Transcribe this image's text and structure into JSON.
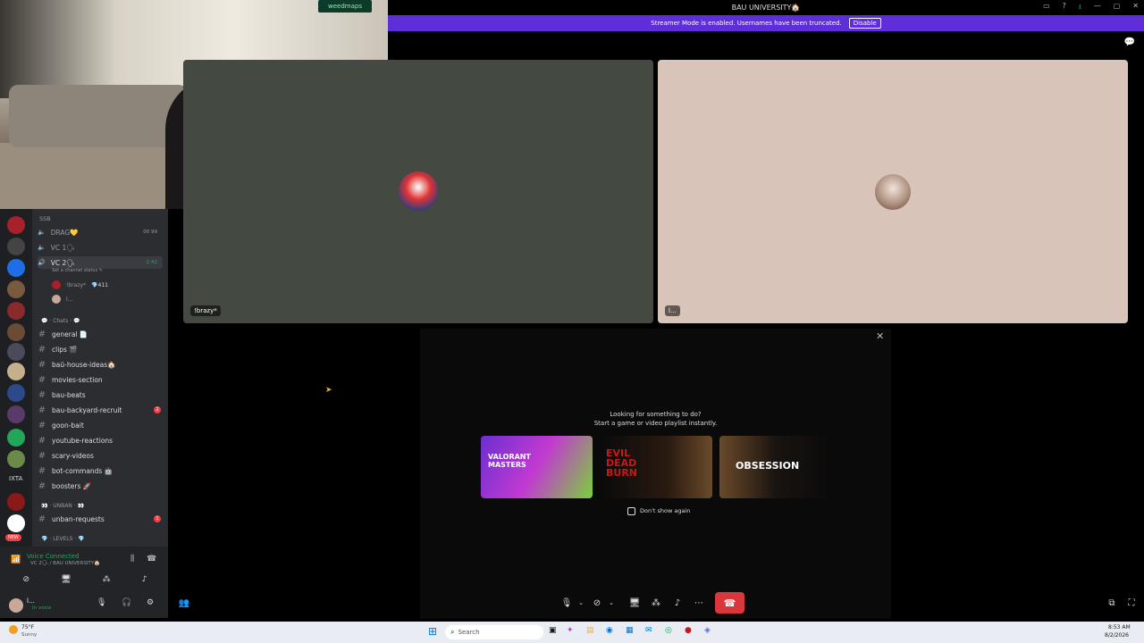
{
  "titlebar": {
    "title": "BAU UNIVERSITY🏠"
  },
  "streamer": {
    "message": "Streamer Mode is enabled. Usernames have been truncated.",
    "disable_label": "Disable",
    "close": "✕"
  },
  "webcam": {
    "logo": "weedmaps"
  },
  "channels": {
    "section_ssb": "SSB",
    "voice": [
      {
        "name": "DRAG💛",
        "meta": "00 99"
      },
      {
        "name": "VC 1🗣"
      },
      {
        "name": "VC 2🗣",
        "meta": "1:42",
        "status": "Set a channel status ✎"
      }
    ],
    "vc_users": [
      {
        "name": "!brazy*",
        "tag": "💎411"
      },
      {
        "name": "l..."
      }
    ],
    "section_chats": "💬 · Chats · 💬",
    "text": [
      {
        "name": "general 📄"
      },
      {
        "name": "clips 🎬"
      },
      {
        "name": "baü-house-ideas🏠"
      },
      {
        "name": "movies-section"
      },
      {
        "name": "bau-beats"
      },
      {
        "name": "bau-backyard-recruit",
        "badge": "2"
      },
      {
        "name": "goon-bait"
      },
      {
        "name": "youtube-reactions"
      },
      {
        "name": "scary-videos"
      },
      {
        "name": "bot-commands 🤖"
      },
      {
        "name": "boosters 🚀"
      }
    ],
    "section_unban": "👀 · UNBAN · 👀",
    "unban_requests": {
      "name": "unban-requests",
      "badge": "1"
    },
    "section_levels": "💎 · LEVELS · 💎"
  },
  "voice_panel": {
    "status": "Voice Connected",
    "location": "VC 2🗣 / BAU UNIVERSITY🏠",
    "user": "l...",
    "user_status": "In voice"
  },
  "tiles": {
    "left_name": "!brazy*",
    "right_name": "l..."
  },
  "activity": {
    "title": "Looking for something to do?",
    "subtitle": "Start a game or video playlist instantly.",
    "cards": [
      "VALORANT MASTERS",
      "EVIL DEAD BURN",
      "OBSESSION"
    ],
    "dont_show": "Don't show again"
  },
  "taskbar": {
    "weather_temp": "75°F",
    "weather_desc": "Sunny",
    "search_placeholder": "Search",
    "time": "8:53 AM",
    "date": "8/2/2026"
  },
  "rail": {
    "ixta": "IXTA",
    "new_badge": "NEW"
  }
}
